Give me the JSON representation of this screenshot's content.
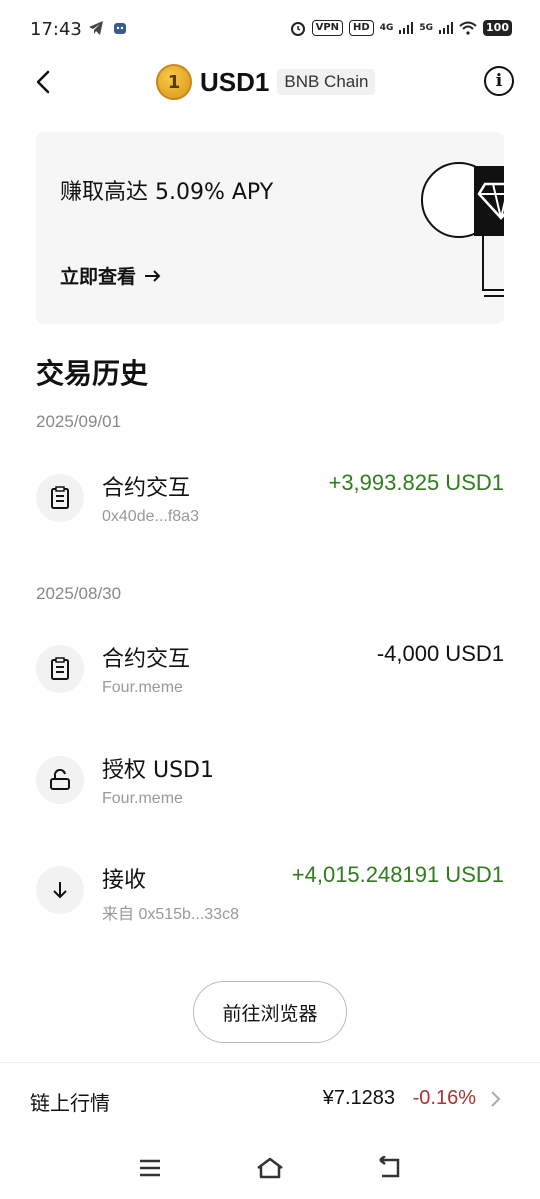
{
  "status_bar": {
    "time": "17:43",
    "vpn": "VPN",
    "hd": "HD",
    "net1": "4G",
    "net2": "5G",
    "battery": "100"
  },
  "header": {
    "coin_symbol": "1",
    "title": "USD1",
    "chain": "BNB Chain"
  },
  "banner": {
    "text": "赚取高达 5.09% APY",
    "link": "立即查看"
  },
  "history": {
    "title": "交易历史",
    "groups": [
      {
        "date": "2025/09/01",
        "items": [
          {
            "title": "合约交互",
            "sub": "0x40de...f8a3",
            "amount": "+3,993.825 USD1",
            "icon": "contract-icon"
          }
        ]
      },
      {
        "date": "2025/08/30",
        "items": [
          {
            "title": "合约交互",
            "sub": "Four.meme",
            "amount": "-4,000 USD1",
            "icon": "contract-icon"
          },
          {
            "title": "授权 USD1",
            "sub": "Four.meme",
            "amount": "",
            "icon": "unlock-icon"
          },
          {
            "title": "接收",
            "sub": "来自 0x515b...33c8",
            "amount": "+4,015.248191 USD1",
            "icon": "arrow-down-icon"
          }
        ]
      }
    ]
  },
  "explorer_button": "前往浏览器",
  "market": {
    "label": "链上行情",
    "price": "¥7.1283",
    "change": "-0.16%"
  },
  "colors": {
    "positive": "#2f7d1c",
    "negative_change": "#a33333"
  }
}
